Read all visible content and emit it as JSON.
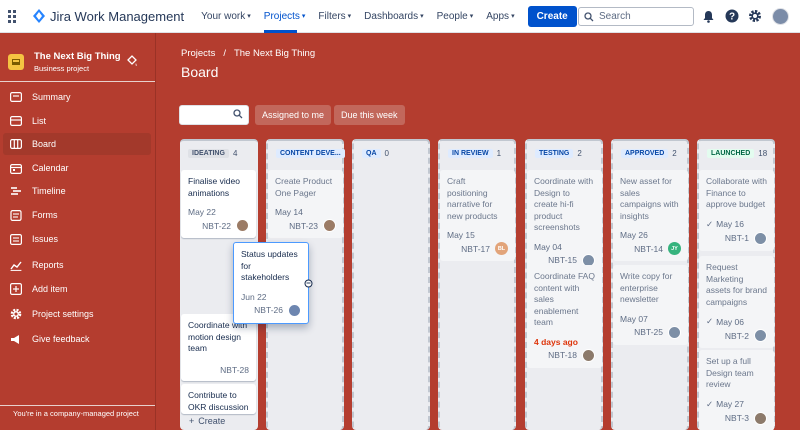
{
  "topbar": {
    "app_name": "Jira Work Management",
    "nav": [
      {
        "label": "Your work",
        "active": false
      },
      {
        "label": "Projects",
        "active": true
      },
      {
        "label": "Filters",
        "active": false
      },
      {
        "label": "Dashboards",
        "active": false
      },
      {
        "label": "People",
        "active": false
      },
      {
        "label": "Apps",
        "active": false
      }
    ],
    "create_label": "Create",
    "search_placeholder": "Search"
  },
  "sidebar": {
    "project_name": "The Next Big Thing",
    "project_type": "Business project",
    "items": [
      {
        "label": "Summary",
        "icon": "summary-icon",
        "active": false
      },
      {
        "label": "List",
        "icon": "list-icon",
        "active": false
      },
      {
        "label": "Board",
        "icon": "board-icon",
        "active": true
      },
      {
        "label": "Calendar",
        "icon": "calendar-icon",
        "active": false
      },
      {
        "label": "Timeline",
        "icon": "timeline-icon",
        "active": false
      },
      {
        "label": "Forms",
        "icon": "forms-icon",
        "active": false
      },
      {
        "label": "Issues",
        "icon": "issues-icon",
        "active": false
      },
      {
        "label": "Reports",
        "icon": "reports-icon",
        "active": false
      },
      {
        "label": "Add item",
        "icon": "add-item-icon",
        "active": false
      },
      {
        "label": "Project settings",
        "icon": "gear-icon",
        "active": false
      },
      {
        "label": "Give feedback",
        "icon": "megaphone-icon",
        "active": false
      }
    ],
    "footer": "You're in a company-managed project"
  },
  "main": {
    "breadcrumb": [
      "Projects",
      "The Next Big Thing"
    ],
    "title": "Board",
    "filters": {
      "assigned_to_me": "Assigned to me",
      "due_this_week": "Due this week"
    },
    "create_label": "Create"
  },
  "columns": [
    {
      "name": "IDEATING",
      "count": "4",
      "color": "grey",
      "cards": [
        {
          "title": "Finalise video animations",
          "date": "May 22",
          "key": "NBT-22"
        },
        {
          "title": "Coordinate with motion design team",
          "date": "",
          "key": "NBT-28"
        },
        {
          "title": "Contribute to OKR discussion",
          "date": "",
          "key": ""
        }
      ]
    },
    {
      "name": "CONTENT DEVE...",
      "count": "",
      "color": "blue",
      "cards": [
        {
          "title": "Create Product One Pager",
          "date": "May 14",
          "key": "NBT-23"
        }
      ]
    },
    {
      "name": "QA",
      "count": "0",
      "color": "blue",
      "cards": []
    },
    {
      "name": "IN REVIEW",
      "count": "1",
      "color": "blue",
      "cards": [
        {
          "title": "Craft positioning narrative for new products",
          "date": "May 15",
          "key": "NBT-17",
          "avatar": "BL"
        }
      ]
    },
    {
      "name": "TESTING",
      "count": "2",
      "color": "blue",
      "cards": [
        {
          "title": "Coordinate with Design to create hi-fi product screenshots",
          "date": "May 04",
          "key": "NBT-15"
        },
        {
          "title": "Coordinate FAQ content with sales enablement team",
          "date": "4 days ago",
          "key": "NBT-18"
        }
      ]
    },
    {
      "name": "APPROVED",
      "count": "2",
      "color": "blue",
      "cards": [
        {
          "title": "New asset for sales campaigns with insights",
          "date": "May 26",
          "key": "NBT-14",
          "avatar": "JY"
        },
        {
          "title": "Write copy for enterprise newsletter",
          "date": "May 07",
          "key": "NBT-25"
        }
      ]
    },
    {
      "name": "LAUNCHED",
      "count": "18",
      "color": "green",
      "cards": [
        {
          "title": "Collaborate with Finance to approve budget",
          "date": "May 16",
          "key": "NBT-1"
        },
        {
          "title": "Request Marketing assets for brand campaigns",
          "date": "May 06",
          "key": "NBT-2"
        },
        {
          "title": "Set up a full Design team review",
          "date": "May 27",
          "key": "NBT-3"
        }
      ]
    }
  ],
  "dragging_card": {
    "title": "Status updates for stakeholders",
    "date": "Jun 22",
    "key": "NBT-26"
  }
}
